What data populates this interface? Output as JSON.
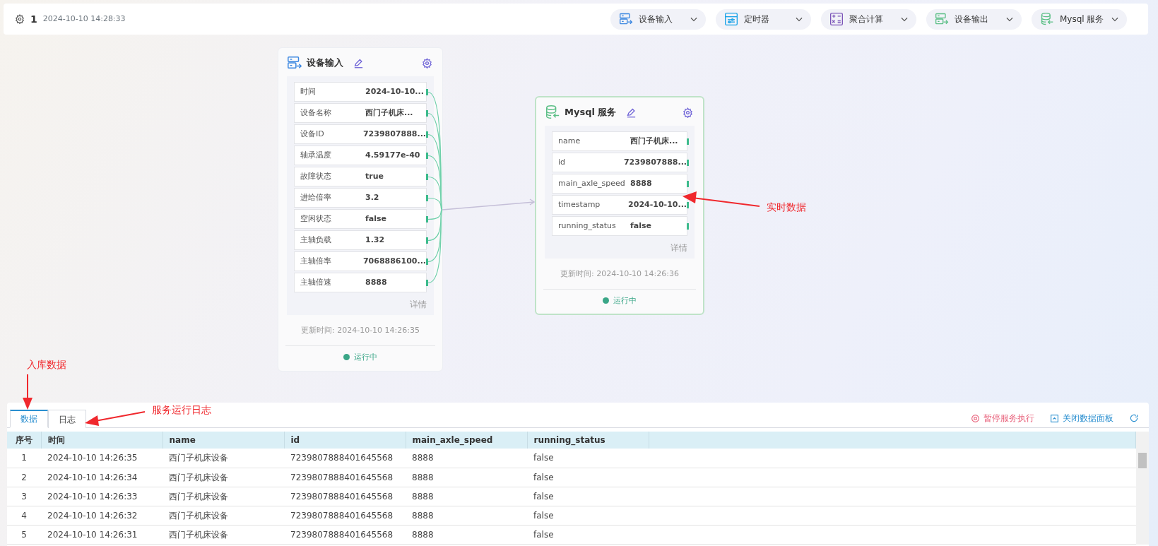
{
  "header": {
    "flow_id": "1",
    "timestamp": "2024-10-10 14:28:33"
  },
  "toolbar": [
    {
      "label": "设备输入",
      "kind": "input"
    },
    {
      "label": "定时器",
      "kind": "timer"
    },
    {
      "label": "聚合计算",
      "kind": "calc"
    },
    {
      "label": "设备输出",
      "kind": "output"
    },
    {
      "label": "Mysql 服务",
      "kind": "db"
    }
  ],
  "nodes": [
    {
      "kind": "input",
      "title": "设备输入",
      "fields": [
        {
          "label": "时间",
          "value": "2024-10-10..."
        },
        {
          "label": "设备名称",
          "value": "西门子机床..."
        },
        {
          "label": "设备ID",
          "value": "7239807888..."
        },
        {
          "label": "轴承温度",
          "value": "4.59177e-40"
        },
        {
          "label": "故障状态",
          "value": "true"
        },
        {
          "label": "进给倍率",
          "value": "3.2"
        },
        {
          "label": "空闲状态",
          "value": "false"
        },
        {
          "label": "主轴负载",
          "value": "1.32"
        },
        {
          "label": "主轴倍率",
          "value": "7068886100..."
        },
        {
          "label": "主轴倍速",
          "value": "8888"
        }
      ],
      "details": "详情",
      "updated": "更新时间: 2024-10-10 14:26:35",
      "status": "运行中",
      "highlighted": false
    },
    {
      "kind": "db",
      "title": "Mysql 服务",
      "fields": [
        {
          "label": "name",
          "value": "西门子机床..."
        },
        {
          "label": "id",
          "value": "7239807888..."
        },
        {
          "label": "main_axle_speed",
          "value": "8888"
        },
        {
          "label": "timestamp",
          "value": "2024-10-10..."
        },
        {
          "label": "running_status",
          "value": "false"
        }
      ],
      "details": "详情",
      "updated": "更新时间: 2024-10-10 14:26:36",
      "status": "运行中",
      "highlighted": true
    }
  ],
  "annotations": [
    {
      "text": "实时数据"
    },
    {
      "text": "入库数据"
    },
    {
      "text": "服务运行日志"
    }
  ],
  "panel": {
    "tabs": [
      {
        "label": "数据",
        "selected": true
      },
      {
        "label": "日志",
        "selected": false
      }
    ],
    "actions": [
      {
        "label": "暂停服务执行",
        "kind": "pause"
      },
      {
        "label": "关闭数据面板",
        "kind": "collapse"
      }
    ],
    "table": {
      "columns": [
        "序号",
        "时间",
        "name",
        "id",
        "main_axle_speed",
        "running_status"
      ],
      "rows": [
        [
          "1",
          "2024-10-10 14:26:35",
          "西门子机床设备",
          "7239807888401645568",
          "8888",
          "false"
        ],
        [
          "2",
          "2024-10-10 14:26:34",
          "西门子机床设备",
          "7239807888401645568",
          "8888",
          "false"
        ],
        [
          "3",
          "2024-10-10 14:26:33",
          "西门子机床设备",
          "7239807888401645568",
          "8888",
          "false"
        ],
        [
          "4",
          "2024-10-10 14:26:32",
          "西门子机床设备",
          "7239807888401645568",
          "8888",
          "false"
        ],
        [
          "5",
          "2024-10-10 14:26:31",
          "西门子机床设备",
          "7239807888401645568",
          "8888",
          "false"
        ]
      ]
    }
  }
}
